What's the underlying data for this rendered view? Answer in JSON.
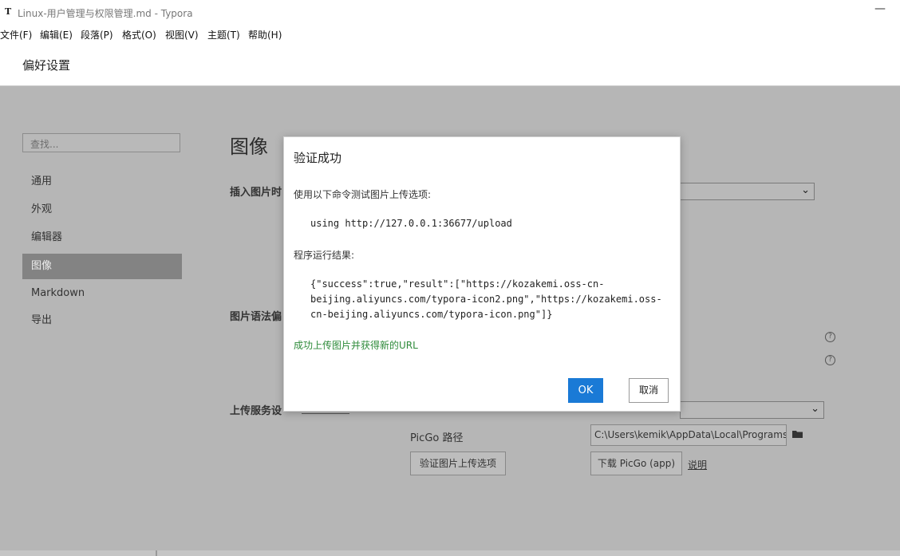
{
  "window": {
    "app_icon": "T",
    "title": "Linux-用户管理与权限管理.md - Typora",
    "minimize": "—"
  },
  "menu": [
    "文件(F)",
    "编辑(E)",
    "段落(P)",
    "格式(O)",
    "视图(V)",
    "主题(T)",
    "帮助(H)"
  ],
  "preferences": {
    "title": "偏好设置",
    "search_placeholder": "查找...",
    "nav": [
      "通用",
      "外观",
      "编辑器",
      "图像",
      "Markdown",
      "导出"
    ],
    "active_nav": "图像"
  },
  "image_section": {
    "title": "图像",
    "insert_label": "插入图片时",
    "syntax_label": "图片语法偏",
    "upload_label": "上传服务设",
    "picgo_path_label": "PicGo 路径",
    "picgo_path_value": "C:\\Users\\kemik\\AppData\\Local\\Programs\\PicGo\\PicGo.exe",
    "verify_button": "验证图片上传选项",
    "download_button": "下载 PicGo (app)",
    "help_link": "说明"
  },
  "dialog": {
    "title": "验证成功",
    "intro": "使用以下命令测试图片上传选项:",
    "command": "using http://127.0.0.1:36677/upload",
    "result_label": "程序运行结果:",
    "result_lines": [
      "{\"success\":true,\"result\":[\"https://kozakemi.oss-cn-",
      "beijing.aliyuncs.com/typora-icon2.png\",\"https://kozakemi.oss-",
      "cn-beijing.aliyuncs.com/typora-icon.png\"]}"
    ],
    "success_message": "成功上传图片并获得新的URL",
    "ok": "OK",
    "cancel": "取消"
  },
  "icons": {
    "help": "help-circle-icon",
    "folder": "folder-icon",
    "dropdown": "chevron-down-icon"
  },
  "colors": {
    "accent": "#1a7ad6",
    "success": "#2e8b3a",
    "overlay": "#b6b6b6",
    "active_nav": "#838383"
  }
}
